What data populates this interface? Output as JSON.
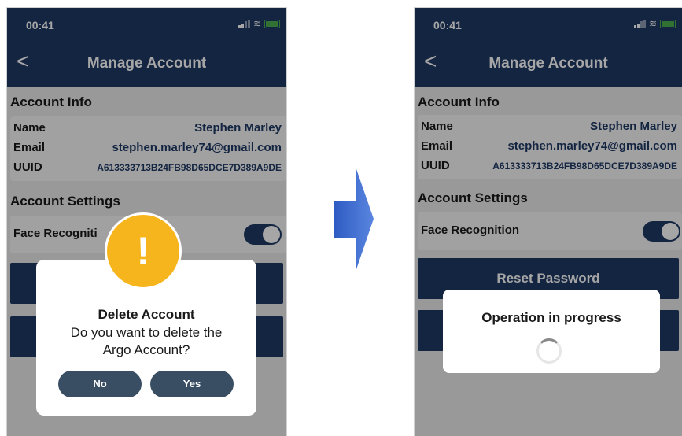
{
  "left": {
    "status": {
      "time": "00:41"
    },
    "nav": {
      "back": "<",
      "title": "Manage Account"
    },
    "account_info": {
      "title": "Account Info",
      "name_label": "Name",
      "name_value": "Stephen Marley",
      "email_label": "Email",
      "email_value": "stephen.marley74@gmail.com",
      "uuid_label": "UUID",
      "uuid_value": "A613333713B24FB98D65DCE7D389A9DE"
    },
    "account_settings": {
      "title": "Account Settings",
      "face_label": "Face Recogniti"
    },
    "dialog": {
      "icon": "!",
      "title": "Delete Account",
      "message_line1": "Do you want to delete the",
      "message_line2": "Argo Account?",
      "no_label": "No",
      "yes_label": "Yes"
    }
  },
  "right": {
    "status": {
      "time": "00:41"
    },
    "nav": {
      "back": "<",
      "title": "Manage Account"
    },
    "account_info": {
      "title": "Account Info",
      "name_label": "Name",
      "name_value": "Stephen Marley",
      "email_label": "Email",
      "email_value": "stephen.marley74@gmail.com",
      "uuid_label": "UUID",
      "uuid_value": "A613333713B24FB98D65DCE7D389A9DE"
    },
    "account_settings": {
      "title": "Account Settings",
      "face_label": "Face Recognition"
    },
    "reset_label": "Reset Password",
    "progress": {
      "text": "Operation in progress"
    }
  },
  "colors": {
    "brand": "#1f3a66",
    "warning": "#f7b51d",
    "arrow": "#3f6bd0"
  },
  "icons": {
    "back": "chevron-left-icon",
    "warning": "exclamation-icon",
    "arrow": "right-arrow-icon"
  }
}
